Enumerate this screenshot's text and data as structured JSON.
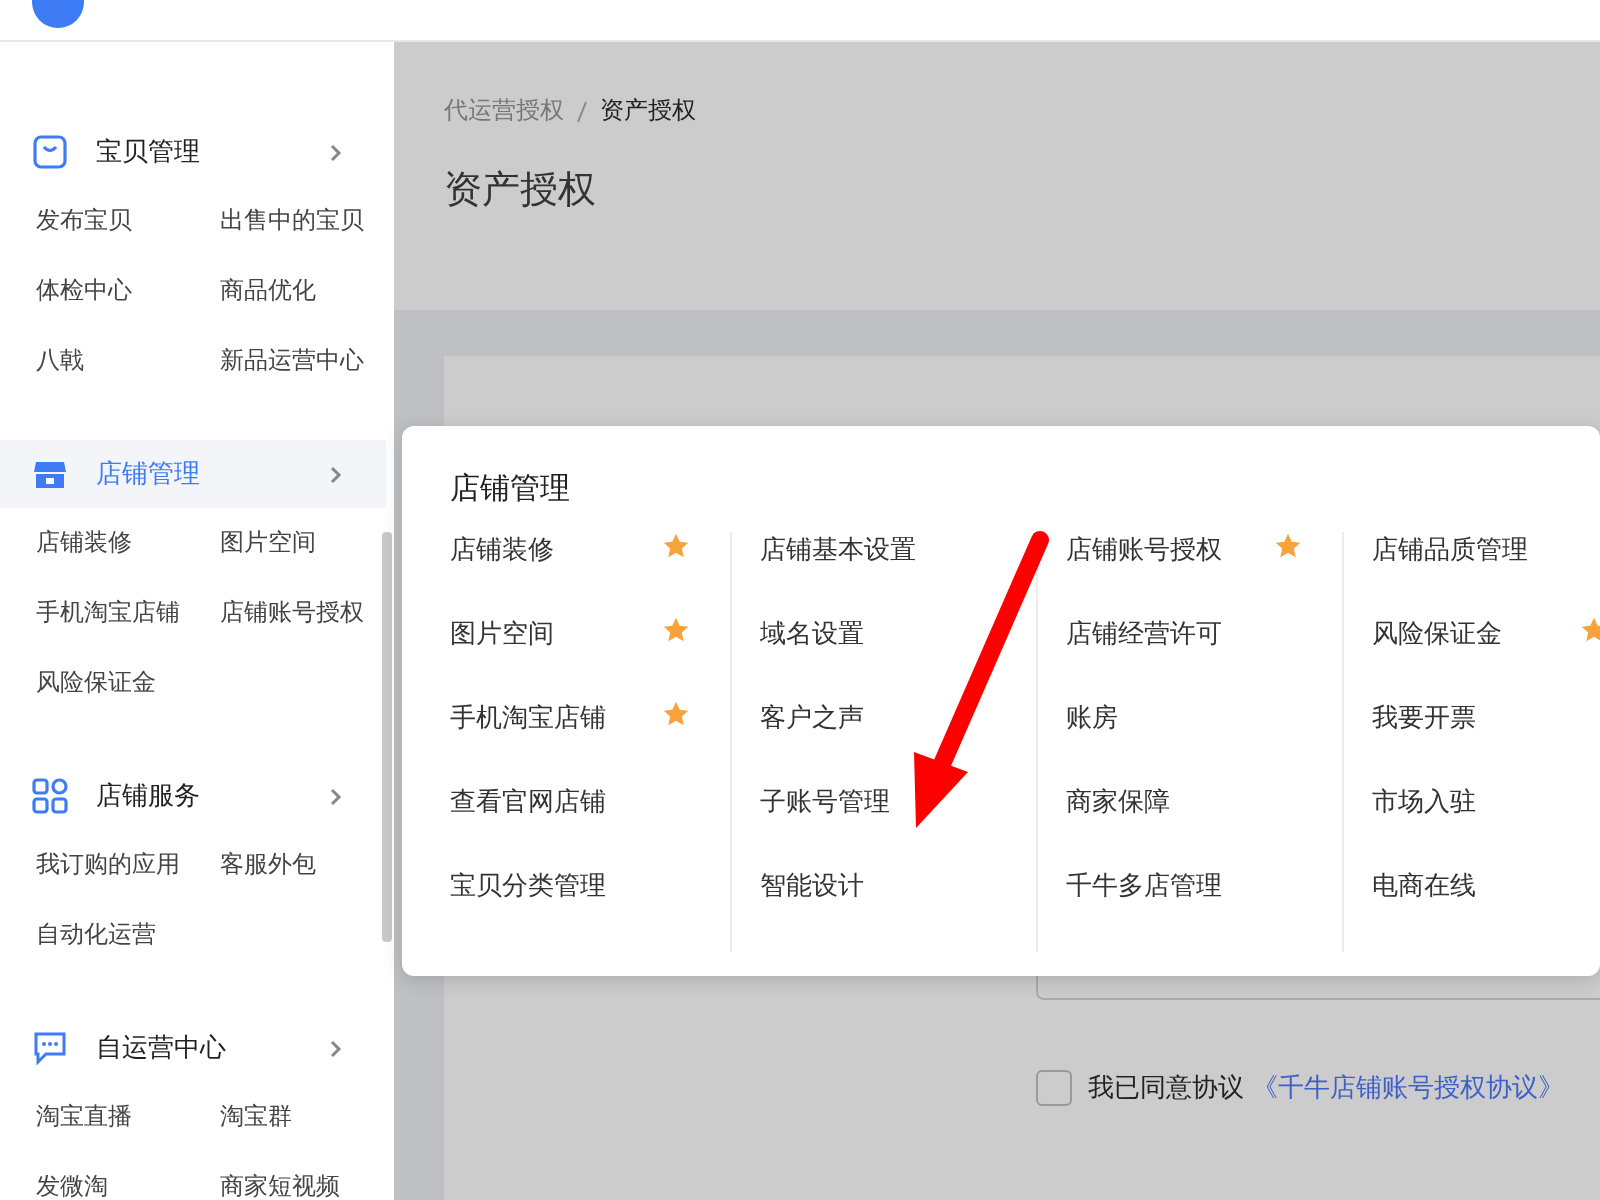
{
  "sidebar": {
    "groups": [
      {
        "kind": "bag",
        "title": "宝贝管理",
        "selected": false,
        "items": [
          "发布宝贝",
          "出售中的宝贝",
          "体检中心",
          "商品优化",
          "八戟",
          "新品运营中心"
        ]
      },
      {
        "kind": "store",
        "title": "店铺管理",
        "selected": true,
        "items": [
          "店铺装修",
          "图片空间",
          "手机淘宝店铺",
          "店铺账号授权",
          "风险保证金"
        ]
      },
      {
        "kind": "apps",
        "title": "店铺服务",
        "selected": false,
        "items": [
          "我订购的应用",
          "客服外包",
          "自动化运营"
        ]
      },
      {
        "kind": "chat",
        "title": "自运营中心",
        "selected": false,
        "items": [
          "淘宝直播",
          "淘宝群",
          "发微淘",
          "商家短视频"
        ]
      }
    ]
  },
  "breadcrumb": [
    {
      "label": "代运营授权",
      "current": false
    },
    {
      "label": "资产授权",
      "current": true
    }
  ],
  "page_title": "资产授权",
  "agreement": {
    "checked": false,
    "text": "我已同意协议",
    "link": "《千牛店铺账号授权协议》"
  },
  "popup": {
    "title": "店铺管理",
    "columns": [
      [
        {
          "label": "店铺装修",
          "starred": true
        },
        {
          "label": "图片空间",
          "starred": true
        },
        {
          "label": "手机淘宝店铺",
          "starred": true
        },
        {
          "label": "查看官网店铺",
          "starred": false
        },
        {
          "label": "宝贝分类管理",
          "starred": false
        }
      ],
      [
        {
          "label": "店铺基本设置",
          "starred": false
        },
        {
          "label": "域名设置",
          "starred": false
        },
        {
          "label": "客户之声",
          "starred": false
        },
        {
          "label": "子账号管理",
          "starred": false
        },
        {
          "label": "智能设计",
          "starred": false
        }
      ],
      [
        {
          "label": "店铺账号授权",
          "starred": true
        },
        {
          "label": "店铺经营许可",
          "starred": false
        },
        {
          "label": "账房",
          "starred": false
        },
        {
          "label": "商家保障",
          "starred": false
        },
        {
          "label": "千牛多店管理",
          "starred": false
        }
      ],
      [
        {
          "label": "店铺品质管理",
          "starred": false
        },
        {
          "label": "风险保证金",
          "starred": true
        },
        {
          "label": "我要开票",
          "starred": false
        },
        {
          "label": "市场入驻",
          "starred": false
        },
        {
          "label": "电商在线",
          "starred": false
        }
      ]
    ]
  }
}
